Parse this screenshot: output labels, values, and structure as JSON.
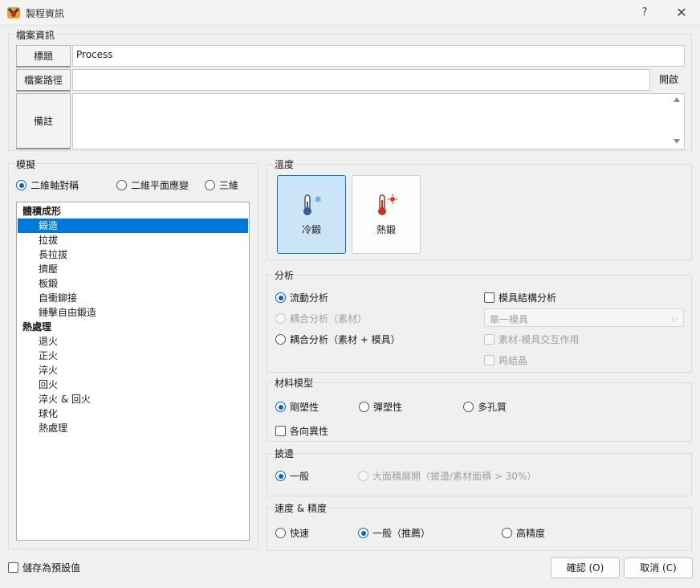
{
  "window": {
    "title": "製程資訊",
    "help": "?",
    "close": "✕"
  },
  "file_info": {
    "group_label": "檔案資訊",
    "title_label": "標題",
    "title_value": "Process",
    "path_label": "檔案路徑",
    "path_value": "",
    "open_button": "開啟",
    "notes_label": "備註",
    "notes_value": ""
  },
  "simulation": {
    "group_label": "模擬",
    "modes": [
      {
        "label": "二維軸對稱",
        "checked": true
      },
      {
        "label": "二維平面應變",
        "checked": false
      },
      {
        "label": "三維",
        "checked": false
      }
    ],
    "list": [
      {
        "label": "體積成形",
        "type": "category"
      },
      {
        "label": "鍛造",
        "type": "item",
        "selected": true
      },
      {
        "label": "拉拔",
        "type": "item"
      },
      {
        "label": "長拉拔",
        "type": "item"
      },
      {
        "label": "擠壓",
        "type": "item"
      },
      {
        "label": "板鍛",
        "type": "item"
      },
      {
        "label": "自衝鉚接",
        "type": "item"
      },
      {
        "label": "錘擊自由鍛造",
        "type": "item"
      },
      {
        "label": "熱處理",
        "type": "category"
      },
      {
        "label": "退火",
        "type": "item"
      },
      {
        "label": "正火",
        "type": "item"
      },
      {
        "label": "淬火",
        "type": "item"
      },
      {
        "label": "回火",
        "type": "item"
      },
      {
        "label": "淬火 & 回火",
        "type": "item"
      },
      {
        "label": "球化",
        "type": "item"
      },
      {
        "label": "熱處理",
        "type": "item"
      }
    ]
  },
  "temperature": {
    "group_label": "溫度",
    "cold_label": "冷鍛",
    "hot_label": "熱鍛",
    "selected": "cold"
  },
  "analysis": {
    "group_label": "分析",
    "flow": "流動分析",
    "coupled_workpiece": "耦合分析（素材）",
    "coupled_both": "耦合分析（素材 + 模具）",
    "die_structure": "模具結構分析",
    "die_combo": "單一模具",
    "interaction": "素材-模具交互作用",
    "recrystallization": "再結晶"
  },
  "material_model": {
    "group_label": "材料模型",
    "rigid_plastic": "剛塑性",
    "elasto_plastic": "彈塑性",
    "porous": "多孔質",
    "anisotropy": "各向異性"
  },
  "flash": {
    "group_label": "披邊",
    "normal": "一般",
    "large_area": "大面積展開（披邊/素材面積 > 30%）"
  },
  "speed": {
    "group_label": "速度 & 精度",
    "fast": "快速",
    "normal": "一般（推薦）",
    "high": "高精度"
  },
  "footer": {
    "save_default": "儲存為預設值",
    "ok": "確認 (O)",
    "cancel": "取消 (C)"
  },
  "colors": {
    "accent": "#0078d7",
    "selected_bg": "#cce4f7"
  }
}
